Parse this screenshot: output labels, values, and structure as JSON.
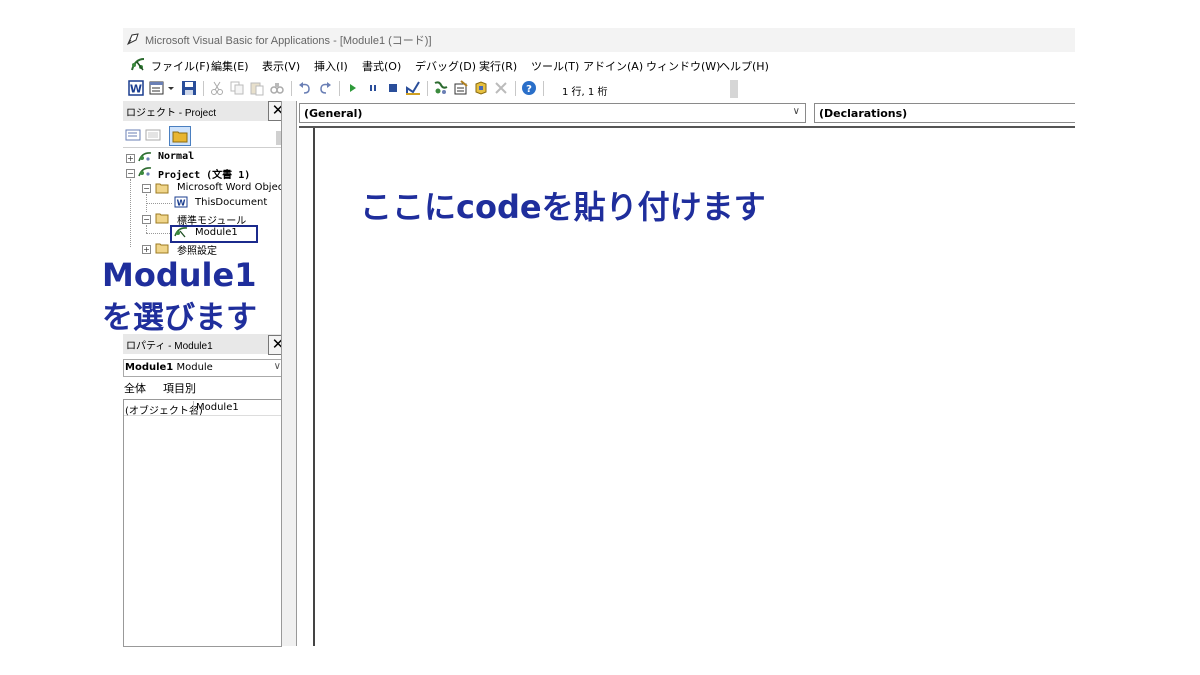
{
  "window": {
    "title": "Microsoft Visual Basic for Applications - [Module1 (コード)]"
  },
  "menu": {
    "items": [
      "ファイル(F)",
      "編集(E)",
      "表示(V)",
      "挿入(I)",
      "書式(O)",
      "デバッグ(D)",
      "実行(R)",
      "ツール(T)",
      "アドイン(A)",
      "ウィンドウ(W)",
      "ヘルプ(H)"
    ]
  },
  "toolbar": {
    "position_label": "1 行, 1 桁",
    "icons": [
      "word-icon",
      "insert-userform-icon",
      "save-icon",
      "cut-icon",
      "copy-icon",
      "paste-icon",
      "find-icon",
      "undo-icon",
      "redo-icon",
      "run-icon",
      "break-icon",
      "reset-icon",
      "design-mode-icon",
      "project-explorer-icon",
      "properties-window-icon",
      "object-browser-icon",
      "toolbox-icon",
      "help-icon"
    ]
  },
  "project_panel": {
    "title": "ロジェクト - Project",
    "close_glyph": "✕",
    "tree": {
      "normal": "Normal",
      "project": "Project (文書 1)",
      "word_objects": "Microsoft Word Object",
      "this_document": "ThisDocument",
      "std_modules": "標準モジュール",
      "module1": "Module1",
      "references": "参照設定"
    }
  },
  "properties_panel": {
    "title": "ロパティ - Module1",
    "close_glyph": "✕",
    "selected_object": "Module1",
    "selected_type": "Module",
    "tabs": [
      "全体",
      "項目別"
    ],
    "row": {
      "key": "(オブジェクト名)",
      "value": "Module1"
    }
  },
  "code_window": {
    "object_combo": "(General)",
    "procedure_combo": "(Declarations)"
  },
  "annotations": {
    "module_label": "Module1",
    "select_label": "を選びます",
    "paste_label": "ここにcodeを貼り付けます"
  },
  "colors": {
    "annotation": "#1f2e9c",
    "selection_box": "#1b2a8c"
  }
}
